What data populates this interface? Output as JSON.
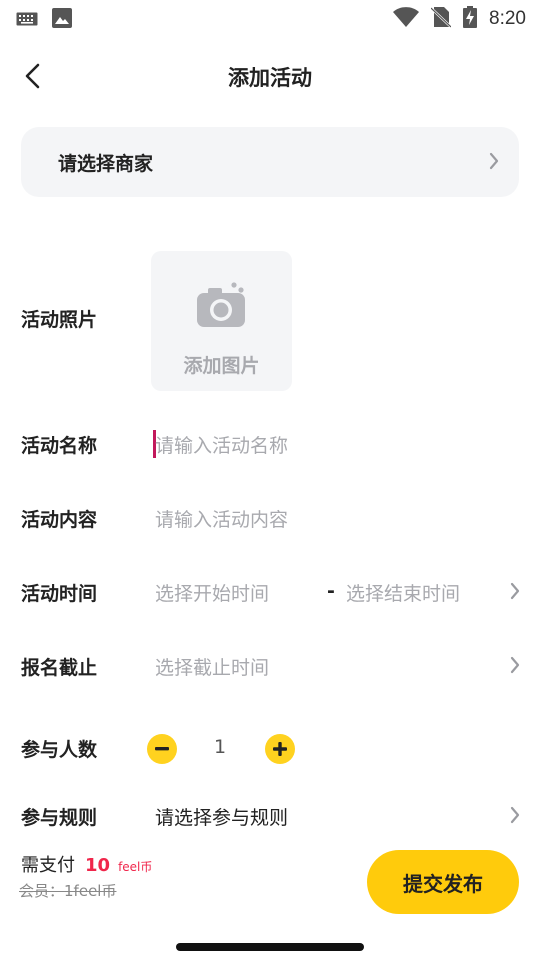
{
  "status_bar": {
    "time": "8:20"
  },
  "header": {
    "title": "添加活动"
  },
  "merchant": {
    "label": "请选择商家"
  },
  "form": {
    "photo": {
      "label": "活动照片",
      "add_text": "添加图片"
    },
    "name": {
      "label": "活动名称",
      "placeholder": "请输入活动名称"
    },
    "content": {
      "label": "活动内容",
      "placeholder": "请输入活动内容"
    },
    "time": {
      "label": "活动时间",
      "start_placeholder": "选择开始时间",
      "separator": "-",
      "end_placeholder": "选择结束时间"
    },
    "deadline": {
      "label": "报名截止",
      "placeholder": "选择截止时间"
    },
    "participants": {
      "label": "参与人数",
      "value": "1"
    },
    "rules": {
      "label": "参与规则",
      "value": "请选择参与规则"
    }
  },
  "footer": {
    "pay_label": "需支付",
    "pay_amount": "10",
    "pay_unit": "feel币",
    "member_label": "会员：",
    "member_price": "1feel币",
    "submit_label": "提交发布"
  },
  "colors": {
    "accent": "#ffcb0c",
    "price": "#f0264b",
    "placeholder": "#a8a9ae",
    "card_bg": "#f4f5f7"
  },
  "icons": [
    "keyboard-icon",
    "image-icon",
    "wifi-icon",
    "no-sim-icon",
    "battery-charging-icon",
    "back-arrow-icon",
    "chevron-right-icon",
    "camera-icon",
    "minus-icon",
    "plus-icon"
  ]
}
